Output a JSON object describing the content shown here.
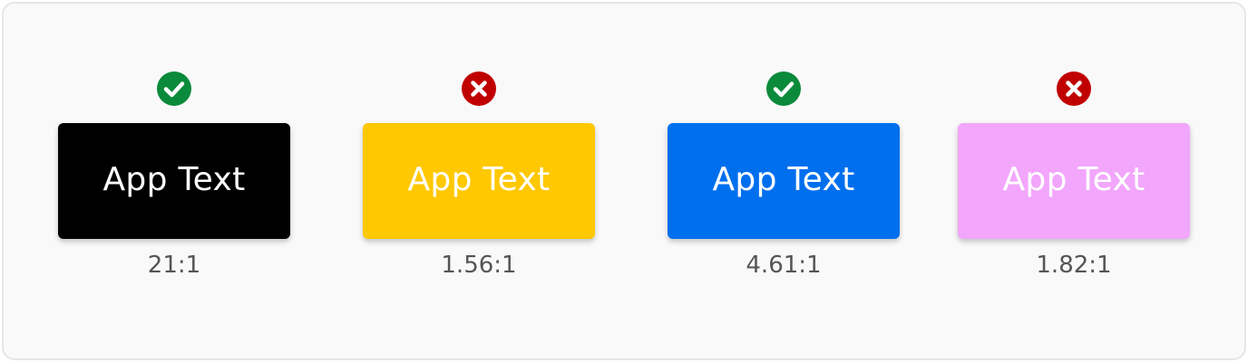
{
  "swatches": [
    {
      "label": "App Text",
      "background": "#000000",
      "text_color": "#ffffff",
      "ratio": "21:1",
      "status": "pass",
      "status_icon": "check-circle-icon"
    },
    {
      "label": "App Text",
      "background": "#FFC800",
      "text_color": "#ffffff",
      "ratio": "1.56:1",
      "status": "fail",
      "status_icon": "x-circle-icon"
    },
    {
      "label": "App Text",
      "background": "#006FEE",
      "text_color": "#ffffff",
      "ratio": "4.61:1",
      "status": "pass",
      "status_icon": "check-circle-icon"
    },
    {
      "label": "App Text",
      "background": "#F2A6FC",
      "text_color": "#ffffff",
      "ratio": "1.82:1",
      "status": "fail",
      "status_icon": "x-circle-icon"
    }
  ],
  "colors": {
    "pass": "#0A8A3A",
    "fail": "#C00000",
    "ratio_text": "#555555",
    "frame_bg": "#f9f9f9",
    "frame_border": "#e6e6e6"
  }
}
